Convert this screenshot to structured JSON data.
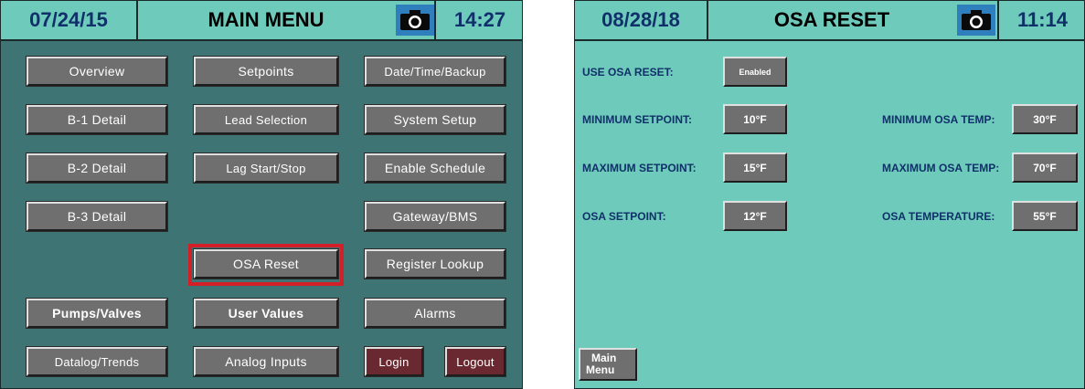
{
  "main_menu": {
    "header": {
      "date": "07/24/15",
      "title": "MAIN MENU",
      "time": "14:27",
      "camera_icon": "camera-icon"
    },
    "buttons": {
      "overview": "Overview",
      "setpoints": "Setpoints",
      "date_time_backup": "Date/Time/Backup",
      "b1_detail": "B-1 Detail",
      "lead_selection": "Lead Selection",
      "system_setup": "System Setup",
      "b2_detail": "B-2 Detail",
      "lag_start_stop": "Lag Start/Stop",
      "enable_schedule": "Enable Schedule",
      "b3_detail": "B-3 Detail",
      "gateway_bms": "Gateway/BMS",
      "osa_reset": "OSA Reset",
      "register_lookup": "Register Lookup",
      "pumps_valves": "Pumps/Valves",
      "user_values": "User Values",
      "alarms": "Alarms",
      "datalog_trends": "Datalog/Trends",
      "analog_inputs": "Analog Inputs",
      "login": "Login",
      "logout": "Logout"
    },
    "colors": {
      "background": "#3f7474",
      "highlight": "#d21f28",
      "login_button": "#6a2830"
    }
  },
  "osa_reset": {
    "header": {
      "date": "08/28/18",
      "title": "OSA RESET",
      "time": "11:14",
      "camera_icon": "camera-icon"
    },
    "use_osa_reset": {
      "label": "USE OSA RESET:",
      "value": "Enabled"
    },
    "minimum_setpoint": {
      "label": "MINIMUM SETPOINT:",
      "value": "10°F"
    },
    "maximum_setpoint": {
      "label": "MAXIMUM SETPOINT:",
      "value": "15°F"
    },
    "osa_setpoint": {
      "label": "OSA SETPOINT:",
      "value": "12°F"
    },
    "minimum_osa_temp": {
      "label": "MINIMUM OSA TEMP:",
      "value": "30°F"
    },
    "maximum_osa_temp": {
      "label": "MAXIMUM OSA TEMP:",
      "value": "70°F"
    },
    "osa_temperature": {
      "label": "OSA TEMPERATURE:",
      "value": "55°F"
    },
    "main_menu_button": {
      "line1": "Main",
      "line2": "Menu"
    },
    "colors": {
      "background": "#6ecbbb",
      "label_text": "#10306a"
    }
  }
}
